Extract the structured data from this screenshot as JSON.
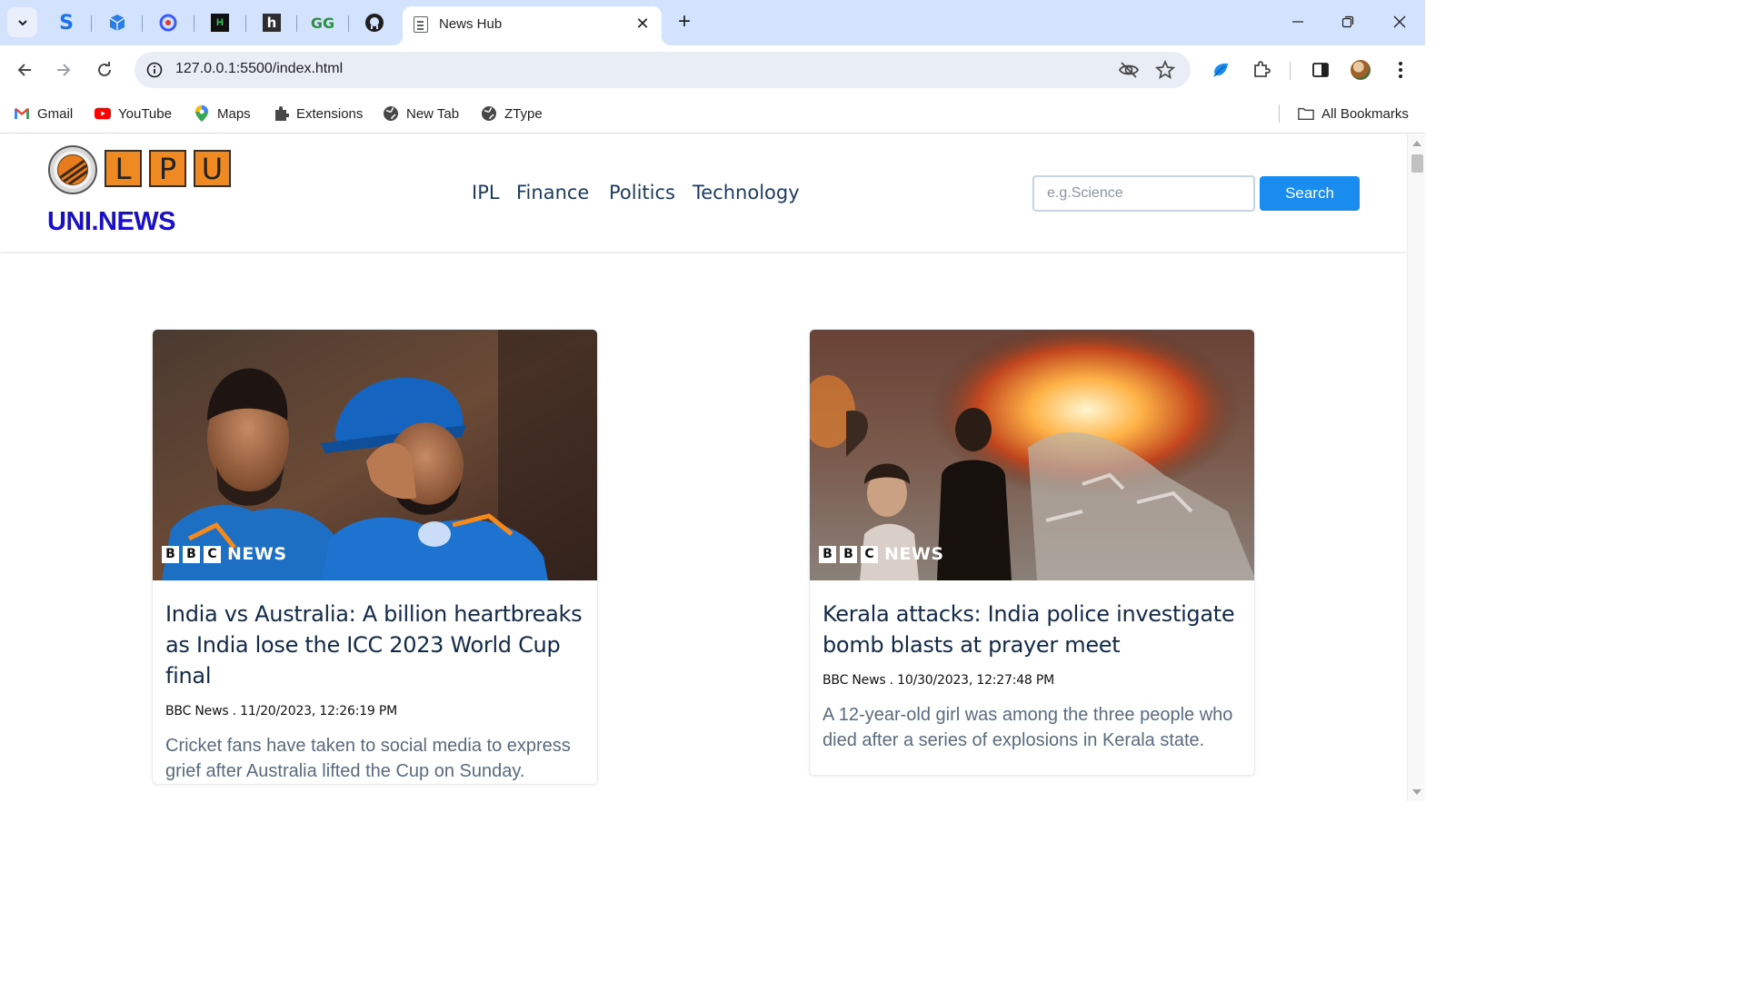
{
  "browser": {
    "tab_title": "News Hub",
    "url": "127.0.0.1:5500/index.html",
    "bookmarks": [
      {
        "label": "Gmail",
        "icon": "gmail-icon"
      },
      {
        "label": "YouTube",
        "icon": "youtube-icon"
      },
      {
        "label": "Maps",
        "icon": "maps-icon"
      },
      {
        "label": "Extensions",
        "icon": "puzzle-icon"
      },
      {
        "label": "New Tab",
        "icon": "globe-icon"
      },
      {
        "label": "ZType",
        "icon": "globe-icon"
      }
    ],
    "all_bookmarks": "All Bookmarks"
  },
  "site": {
    "logo_letters": [
      "L",
      "P",
      "U"
    ],
    "brand": "UNI.NEWS",
    "nav": [
      "IPL",
      "Finance",
      "Politics",
      "Technology"
    ],
    "search_placeholder": "e.g.Science",
    "search_button": "Search"
  },
  "articles": [
    {
      "title": "India vs Australia: A billion heartbreaks as India lose the ICC 2023 World Cup final",
      "meta": "BBC News . 11/20/2023, 12:26:19 PM",
      "description": "Cricket fans have taken to social media to express grief after Australia lifted the Cup on Sunday.",
      "image_badge": [
        "B",
        "B",
        "C",
        "NEWS"
      ]
    },
    {
      "title": "Kerala attacks: India police investigate bomb blasts at prayer meet",
      "meta": "BBC News . 10/30/2023, 12:27:48 PM",
      "description": "A 12-year-old girl was among the three people who died after a series of explosions in Kerala state.",
      "image_badge": [
        "B",
        "B",
        "C",
        "NEWS"
      ]
    }
  ],
  "colors": {
    "tabstrip": "#d3e3fd",
    "brand": "#1a10c8",
    "logo_orange": "#ef8a23",
    "search_button": "#1a8cef",
    "title_text": "#13294b"
  }
}
